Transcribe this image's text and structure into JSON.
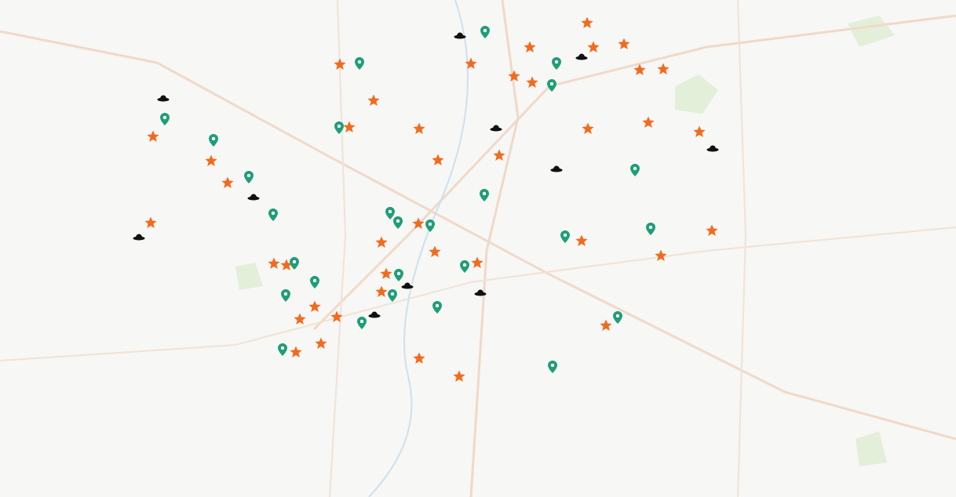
{
  "markers": [
    {
      "kind": "star"
    },
    {
      "kind": "star"
    },
    {
      "kind": "star"
    },
    {
      "kind": "star"
    },
    {
      "kind": "star"
    },
    {
      "kind": "star"
    },
    {
      "kind": "star"
    },
    {
      "kind": "star"
    },
    {
      "kind": "star"
    },
    {
      "kind": "star"
    },
    {
      "kind": "star"
    },
    {
      "kind": "star"
    },
    {
      "kind": "star"
    },
    {
      "kind": "star"
    },
    {
      "kind": "star"
    },
    {
      "kind": "star"
    },
    {
      "kind": "star"
    },
    {
      "kind": "star"
    },
    {
      "kind": "star"
    },
    {
      "kind": "star"
    },
    {
      "kind": "star"
    },
    {
      "kind": "star"
    },
    {
      "kind": "star"
    },
    {
      "kind": "star"
    },
    {
      "kind": "star"
    },
    {
      "kind": "star"
    },
    {
      "kind": "star"
    },
    {
      "kind": "star"
    },
    {
      "kind": "star"
    },
    {
      "kind": "star"
    },
    {
      "kind": "star"
    },
    {
      "kind": "star"
    },
    {
      "kind": "star"
    },
    {
      "kind": "star"
    },
    {
      "kind": "star"
    },
    {
      "kind": "star"
    },
    {
      "kind": "star"
    },
    {
      "kind": "star"
    },
    {
      "kind": "star"
    },
    {
      "kind": "star"
    },
    {
      "kind": "star"
    },
    {
      "kind": "pin"
    },
    {
      "kind": "pin"
    },
    {
      "kind": "pin"
    },
    {
      "kind": "pin"
    },
    {
      "kind": "pin"
    },
    {
      "kind": "pin"
    },
    {
      "kind": "pin"
    },
    {
      "kind": "pin"
    },
    {
      "kind": "pin"
    },
    {
      "kind": "pin"
    },
    {
      "kind": "pin"
    },
    {
      "kind": "pin"
    },
    {
      "kind": "pin"
    },
    {
      "kind": "pin"
    },
    {
      "kind": "pin"
    },
    {
      "kind": "pin"
    },
    {
      "kind": "pin"
    },
    {
      "kind": "pin"
    },
    {
      "kind": "pin"
    },
    {
      "kind": "pin"
    },
    {
      "kind": "pin"
    },
    {
      "kind": "pin"
    },
    {
      "kind": "pin"
    },
    {
      "kind": "pin"
    },
    {
      "kind": "pin"
    },
    {
      "kind": "pin"
    },
    {
      "kind": "pin"
    },
    {
      "kind": "hat"
    },
    {
      "kind": "hat"
    },
    {
      "kind": "hat"
    },
    {
      "kind": "hat"
    },
    {
      "kind": "hat"
    },
    {
      "kind": "hat"
    },
    {
      "kind": "hat"
    },
    {
      "kind": "hat"
    },
    {
      "kind": "hat"
    },
    {
      "kind": "hat"
    },
    {
      "kind": "hat"
    }
  ]
}
